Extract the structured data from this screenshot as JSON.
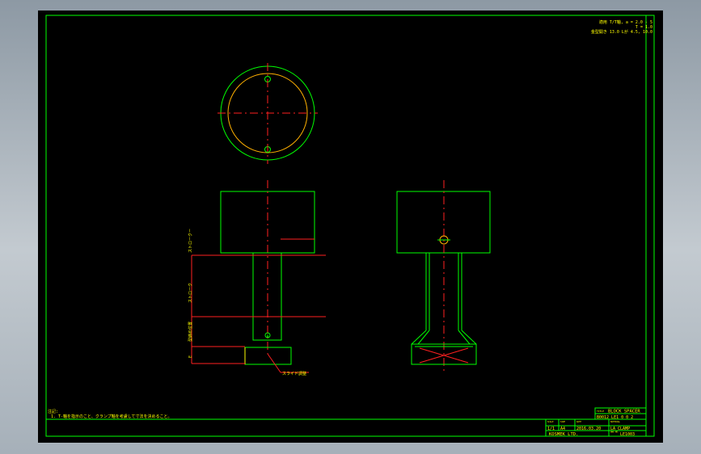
{
  "drawing": {
    "corner_notes": [
      "適用 T/T軸, a = 2.0 - 5",
      "T = 1.0",
      "金型開き 13.0 Lが 4.5, 10.0"
    ],
    "notes_heading": "注記:",
    "notes_line": "1. T-軸を指示のこと、クランプ軸を考慮して寸法を決めること。",
    "side_view_labels": [
      "ストロークー",
      "ストローク",
      "型締め位置",
      "E"
    ],
    "callout_label": "スライド調整",
    "center_mark": "A"
  },
  "title_block": {
    "title_label": "TITLE",
    "title_value": "BLOCK SPACER",
    "part_no_value": "B0012 LE1 0 0 2",
    "scale": "1/1",
    "size": "A4",
    "date": "2016.03.20",
    "material": "LA CLAMP",
    "company": "KOSMEK LTD.",
    "drawing_no": "LE1003",
    "header_labels": [
      "SCALE",
      "SIZE",
      "DATE",
      "MATERIAL",
      "TITLE",
      "DWG NO."
    ]
  },
  "colors": {
    "outline": "#00ff00",
    "center_lines": "#ff2020",
    "hidden_edge": "#ffb000",
    "text": "#ffff00",
    "background": "#000000"
  }
}
